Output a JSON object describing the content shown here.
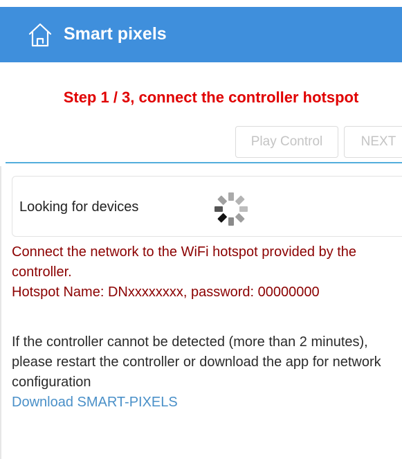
{
  "header": {
    "title": "Smart pixels",
    "icon": "home-icon",
    "color": "#3f8fdc"
  },
  "step": {
    "text": "Step 1 / 3, connect the controller hotspot",
    "color": "#e00000"
  },
  "buttons": {
    "play_control": "Play Control",
    "next": "NEXT"
  },
  "device_search": {
    "label": "Looking for devices",
    "spinner_icon": "loading-spinner-icon"
  },
  "info": {
    "line1": "Connect the network to the WiFi hotspot provided by the controller.",
    "line2": "Hotspot Name: DNxxxxxxxx, password: 00000000",
    "color": "#8b0000"
  },
  "help": {
    "text": "If the controller cannot be detected (more than 2 minutes), please restart the controller or download the app for network configuration",
    "download_link": "Download SMART-PIXELS",
    "link_color": "#4a90c8"
  }
}
